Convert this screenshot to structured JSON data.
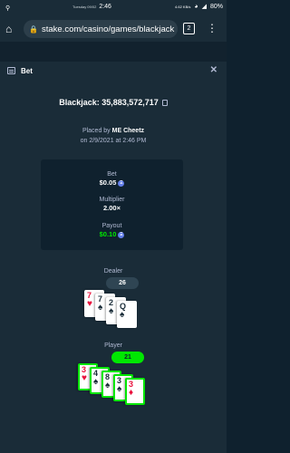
{
  "statusbar": {
    "day": "Tuesday 09/02",
    "time": "2:46",
    "data_speed": "4.62 KB/s",
    "battery": "80%"
  },
  "browser": {
    "url": "stake.com/casino/games/blackjack",
    "tab_count": "2"
  },
  "modal": {
    "title": "Bet",
    "bet_id": "Blackjack: 35,883,572,717",
    "placed_prefix": "Placed by",
    "placed_user": "ME Cheetz",
    "placed_date": "on 2/9/2021 at 2:46 PM",
    "bet_label": "Bet",
    "bet_value": "$0.05",
    "multiplier_label": "Multiplier",
    "multiplier_value": "2.00×",
    "payout_label": "Payout",
    "payout_value": "$0.10",
    "currency_icon": "eth-coin-icon",
    "dealer_label": "Dealer",
    "dealer_total": "26",
    "player_label": "Player",
    "player_total": "21"
  },
  "dealer_cards": [
    {
      "rank": "7",
      "suit": "♥",
      "color": "red"
    },
    {
      "rank": "7",
      "suit": "♠",
      "color": "black"
    },
    {
      "rank": "2",
      "suit": "♠",
      "color": "black"
    },
    {
      "rank": "Q",
      "suit": "♠",
      "color": "black"
    }
  ],
  "player_cards": [
    {
      "rank": "3",
      "suit": "♥",
      "color": "red"
    },
    {
      "rank": "4",
      "suit": "♠",
      "color": "black"
    },
    {
      "rank": "8",
      "suit": "♠",
      "color": "black"
    },
    {
      "rank": "3",
      "suit": "♠",
      "color": "black"
    },
    {
      "rank": "3",
      "suit": "♦",
      "color": "red"
    }
  ],
  "colors": {
    "background": "#0f212e",
    "panel": "#1a2c38",
    "muted_text": "#b1bad3",
    "win_green": "#00e701",
    "heart_red": "#e9113c"
  }
}
